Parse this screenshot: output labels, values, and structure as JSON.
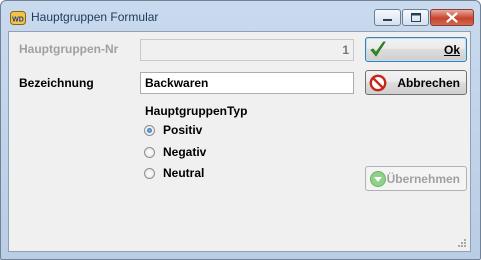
{
  "window": {
    "title": "Hauptgruppen Formular",
    "icon": "wd-app-icon",
    "controls": [
      "minimize-icon",
      "maximize-icon",
      "close-icon"
    ]
  },
  "form": {
    "nr_label": "Hauptgruppen-Nr",
    "nr_value": "1",
    "bezeichnung_label": "Bezeichnung",
    "bezeichnung_value": "Backwaren",
    "typ_group_label": "HauptgruppenTyp",
    "typ_options": [
      {
        "label": "Positiv",
        "checked": true
      },
      {
        "label": "Negativ",
        "checked": false
      },
      {
        "label": "Neutral",
        "checked": false
      }
    ]
  },
  "buttons": {
    "ok": "Ok",
    "cancel": "Abbrechen",
    "apply": "Übernehmen"
  },
  "colors": {
    "ok_check": "#2e9a27",
    "cancel_red": "#c8261b",
    "apply_disabled_green": "#8fd08a"
  }
}
